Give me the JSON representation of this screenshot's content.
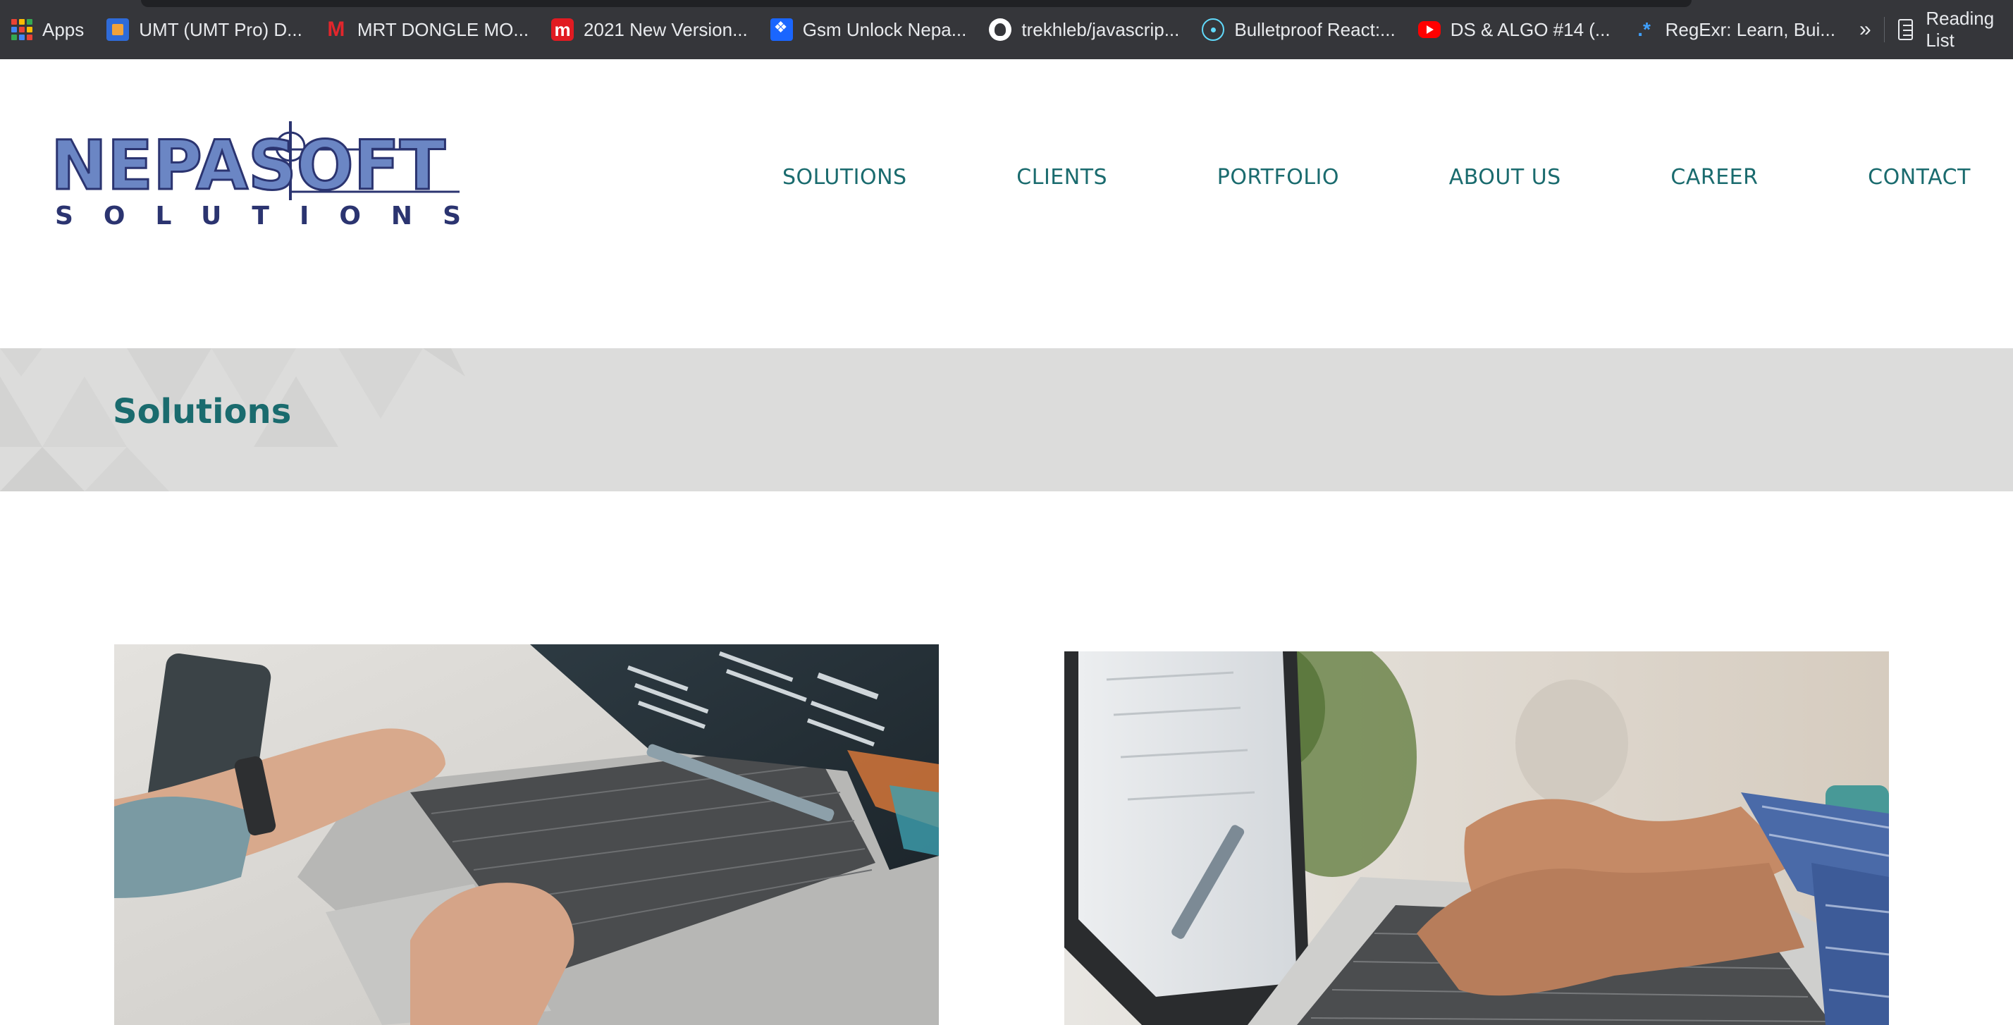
{
  "bookmarks": {
    "apps": "Apps",
    "items": [
      {
        "label": "UMT (UMT Pro) D...",
        "icon": "umt-icon"
      },
      {
        "label": "MRT DONGLE MO...",
        "icon": "mrt-icon"
      },
      {
        "label": "2021 New Version...",
        "icon": "red-m-icon"
      },
      {
        "label": "Gsm Unlock Nepa...",
        "icon": "dropbox-icon"
      },
      {
        "label": "trekhleb/javascrip...",
        "icon": "github-icon"
      },
      {
        "label": "Bulletproof React:...",
        "icon": "react-icon"
      },
      {
        "label": "DS & ALGO #14 (...",
        "icon": "youtube-icon"
      },
      {
        "label": "RegExr: Learn, Bui...",
        "icon": "regexr-icon"
      }
    ],
    "more": "»",
    "reading_list": "Reading List"
  },
  "site": {
    "logo_text": "NEPASOFT",
    "logo_subtext": "SOLUTIONS",
    "nav": [
      "SOLUTIONS",
      "CLIENTS",
      "PORTFOLIO",
      "ABOUT US",
      "CAREER",
      "CONTACT"
    ]
  },
  "page": {
    "title": "Solutions"
  },
  "colors": {
    "accent": "#1a6b6e",
    "logo_blue": "#6b86c4",
    "logo_dark": "#2b3470",
    "band_bg": "#dcdcdb",
    "bookmark_bar": "#35363a"
  }
}
